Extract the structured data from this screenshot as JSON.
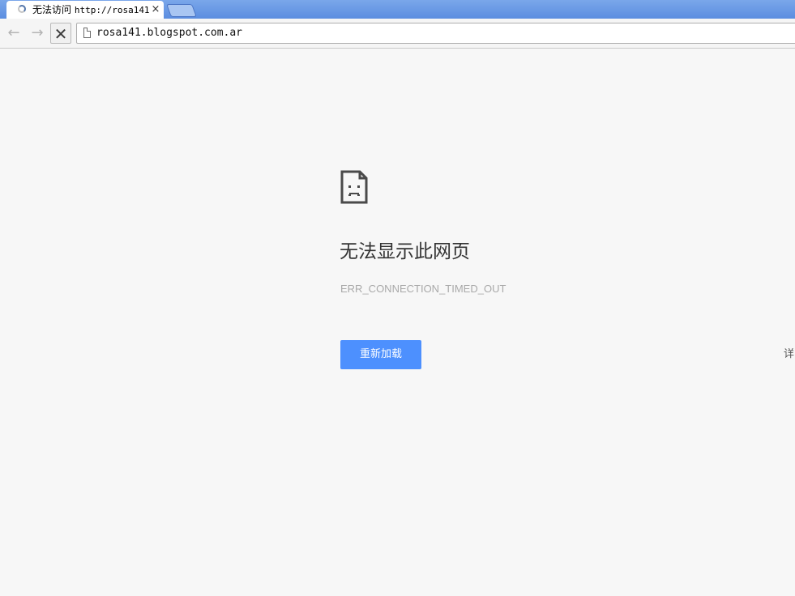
{
  "tab": {
    "title_prefix": "无法访问",
    "title_url": "http://rosa141",
    "close_glyph": "×",
    "spinner_icon": "loading-spinner-icon"
  },
  "toolbar": {
    "back_glyph": "←",
    "forward_glyph": "→",
    "stop_glyph": "✕",
    "page_icon": "page-icon",
    "url": "rosa141.blogspot.com.ar"
  },
  "error_page": {
    "icon": "sad-page-icon",
    "title": "无法显示此网页",
    "error_code": "ERR_CONNECTION_TIMED_OUT",
    "reload_label": "重新加载",
    "details_label": "详"
  },
  "colors": {
    "tabstrip": "#5b8de0",
    "button_blue": "#4d90fe",
    "page_background": "#f7f7f7",
    "title_text": "#333333",
    "error_code_text": "#a9a9a9"
  }
}
